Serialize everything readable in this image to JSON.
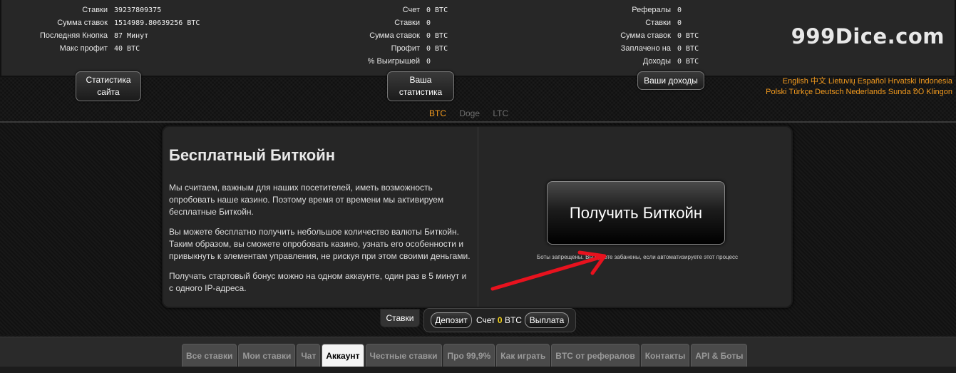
{
  "site_stats": [
    {
      "label": "Ставки",
      "value": "39237809375"
    },
    {
      "label": "Сумма ставок",
      "value": "1514989.80639256 BTC"
    },
    {
      "label": "Последняя Кнопка",
      "value": "87 Минут"
    },
    {
      "label": "Макс профит",
      "value": "40 BTC"
    }
  ],
  "your_stats": [
    {
      "label": "Счет",
      "value": "0 BTC"
    },
    {
      "label": "Ставки",
      "value": "0"
    },
    {
      "label": "Сумма ставок",
      "value": "0 BTC"
    },
    {
      "label": "Профит",
      "value": "0 BTC"
    },
    {
      "label": "% Выигрышей",
      "value": "0"
    }
  ],
  "income_stats": [
    {
      "label": "Рефералы",
      "value": "0"
    },
    {
      "label": "Ставки",
      "value": "0"
    },
    {
      "label": "Сумма ставок",
      "value": "0 BTC"
    },
    {
      "label": "Заплачено на",
      "value": "0 BTC"
    },
    {
      "label": "Доходы",
      "value": "0 BTC"
    }
  ],
  "brand": "999Dice.com",
  "panel_buttons": {
    "site_stats_line1": "Статистика",
    "site_stats_line2": "сайта",
    "your_stats_line1": "Ваша",
    "your_stats_line2": "статистика",
    "your_income": "Ваши доходы"
  },
  "languages_row1": [
    "English",
    "中文",
    "Lietuvių",
    "Español",
    "Hrvatski",
    "Indonesia"
  ],
  "languages_row2": [
    "Polski",
    "Türkçe",
    "Deutsch",
    "Nederlands",
    "Sunda",
    "ᱚᱛ",
    "Klingon"
  ],
  "currencies": {
    "active": "BTC",
    "other1": "Doge",
    "other2": "LTC"
  },
  "faucet": {
    "title": "Бесплатный Биткойн",
    "p1": "Мы считаем, важным для наших посетителей, иметь возможность опробовать наше казино. Поэтому время от времени мы активируем бесплатные Биткойн.",
    "p2": "Вы можете бесплатно получить небольшое количество валюты Биткойн. Таким образом, вы сможете опробовать казино, узнать его особенности и привыкнуть к элементам управления, не рискуя при этом своими деньгами.",
    "p3": "Получать стартовый бонус можно на одном аккаунте, один раз в 5 минут и с одного IP-адреса.",
    "button": "Получить Биткойн",
    "note": "Боты запрещены. Вы будете забанены, если автоматизируете этот процесс"
  },
  "account_bar": {
    "bets_tab": "Ставки",
    "deposit": "Депозит",
    "balance_label": "Счет",
    "balance_value": "0",
    "balance_unit": "BTC",
    "withdraw": "Выплата"
  },
  "nav_tabs": [
    "Все ставки",
    "Мои ставки",
    "Чат",
    "Аккаунт",
    "Честные ставки",
    "Про 99,9%",
    "Как играть",
    "BTC от рефералов",
    "Контакты",
    "API & Боты"
  ],
  "active_tab": "Аккаунт",
  "colors": {
    "accent_orange": "#f29a1e",
    "balance_yellow": "#f2d21e",
    "arrow_red": "#e8121e"
  }
}
